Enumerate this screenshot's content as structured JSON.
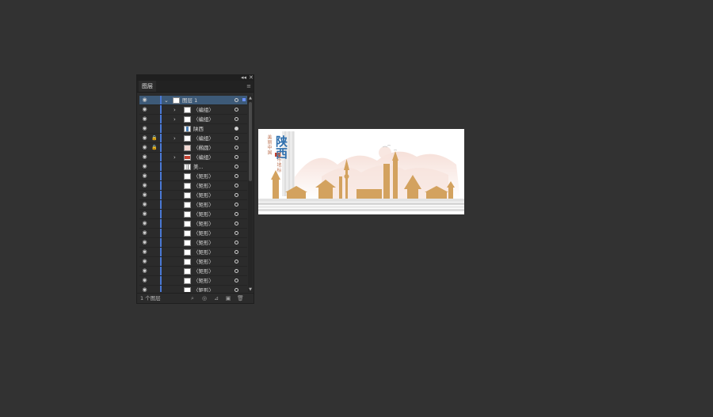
{
  "panel": {
    "tab_label": "图层",
    "collapse_glyph": "◂◂",
    "close_glyph": "✕",
    "menu_glyph": "≡",
    "footer_count": "1 个图层"
  },
  "layers": [
    {
      "name": "图层 1",
      "eye": true,
      "lock": false,
      "chevron": "⌄",
      "thumb": "white",
      "target": "open",
      "selected": true
    },
    {
      "name": "〈编组〉",
      "eye": true,
      "lock": false,
      "chevron": "›",
      "thumb": "white",
      "target": "open"
    },
    {
      "name": "〈编组〉",
      "eye": true,
      "lock": false,
      "chevron": "›",
      "thumb": "white",
      "target": "open"
    },
    {
      "name": "陕西",
      "eye": true,
      "lock": false,
      "chevron": "",
      "thumb": "blue",
      "target": "filled"
    },
    {
      "name": "〈编组〉",
      "eye": true,
      "lock": true,
      "chevron": "›",
      "thumb": "white",
      "target": "open"
    },
    {
      "name": "〈椭圆〉",
      "eye": true,
      "lock": true,
      "chevron": "",
      "thumb": "pink",
      "target": "open"
    },
    {
      "name": "〈编组〉",
      "eye": true,
      "lock": false,
      "chevron": "›",
      "thumb": "red",
      "target": "open"
    },
    {
      "name": "美...",
      "eye": true,
      "lock": false,
      "chevron": "",
      "thumb": "bars",
      "target": "open"
    },
    {
      "name": "〈矩形〉",
      "eye": true,
      "lock": false,
      "chevron": "",
      "thumb": "white",
      "target": "open"
    },
    {
      "name": "〈矩形〉",
      "eye": true,
      "lock": false,
      "chevron": "",
      "thumb": "white",
      "target": "open"
    },
    {
      "name": "〈矩形〉",
      "eye": true,
      "lock": false,
      "chevron": "",
      "thumb": "white",
      "target": "open"
    },
    {
      "name": "〈矩形〉",
      "eye": true,
      "lock": false,
      "chevron": "",
      "thumb": "white",
      "target": "open"
    },
    {
      "name": "〈矩形〉",
      "eye": true,
      "lock": false,
      "chevron": "",
      "thumb": "white",
      "target": "open"
    },
    {
      "name": "〈矩形〉",
      "eye": true,
      "lock": false,
      "chevron": "",
      "thumb": "white",
      "target": "open"
    },
    {
      "name": "〈矩形〉",
      "eye": true,
      "lock": false,
      "chevron": "",
      "thumb": "white",
      "target": "open"
    },
    {
      "name": "〈矩形〉",
      "eye": true,
      "lock": false,
      "chevron": "",
      "thumb": "white",
      "target": "open"
    },
    {
      "name": "〈矩形〉",
      "eye": true,
      "lock": false,
      "chevron": "",
      "thumb": "white",
      "target": "open"
    },
    {
      "name": "〈矩形〉",
      "eye": true,
      "lock": false,
      "chevron": "",
      "thumb": "white",
      "target": "open"
    },
    {
      "name": "〈矩形〉",
      "eye": true,
      "lock": false,
      "chevron": "",
      "thumb": "white",
      "target": "open"
    },
    {
      "name": "〈矩形〉",
      "eye": true,
      "lock": false,
      "chevron": "",
      "thumb": "white",
      "target": "open"
    },
    {
      "name": "〈矩形〉",
      "eye": true,
      "lock": false,
      "chevron": "",
      "thumb": "white",
      "target": "open"
    }
  ],
  "footer_buttons": [
    {
      "name": "locate-object-icon",
      "glyph": "⌕"
    },
    {
      "name": "make-clipping-mask-icon",
      "glyph": "◎"
    },
    {
      "name": "create-sublayer-icon",
      "glyph": "⊿"
    },
    {
      "name": "create-new-layer-icon",
      "glyph": "▣"
    },
    {
      "name": "delete-icon",
      "glyph": "🗑"
    }
  ],
  "artwork": {
    "title": "陕西",
    "subtitle_line1": "美丽中国",
    "subtitle_line2": "城市地标",
    "title_color": "#2e6fae",
    "building_color": "#d3a25f",
    "mountain_color": "#f4d8cf",
    "stamp_color": "#c2402f"
  },
  "colors": {
    "background": "#323232",
    "panel": "#2b2b2b",
    "selection": "#3d5a78",
    "layer_color": "#4a79d6"
  }
}
